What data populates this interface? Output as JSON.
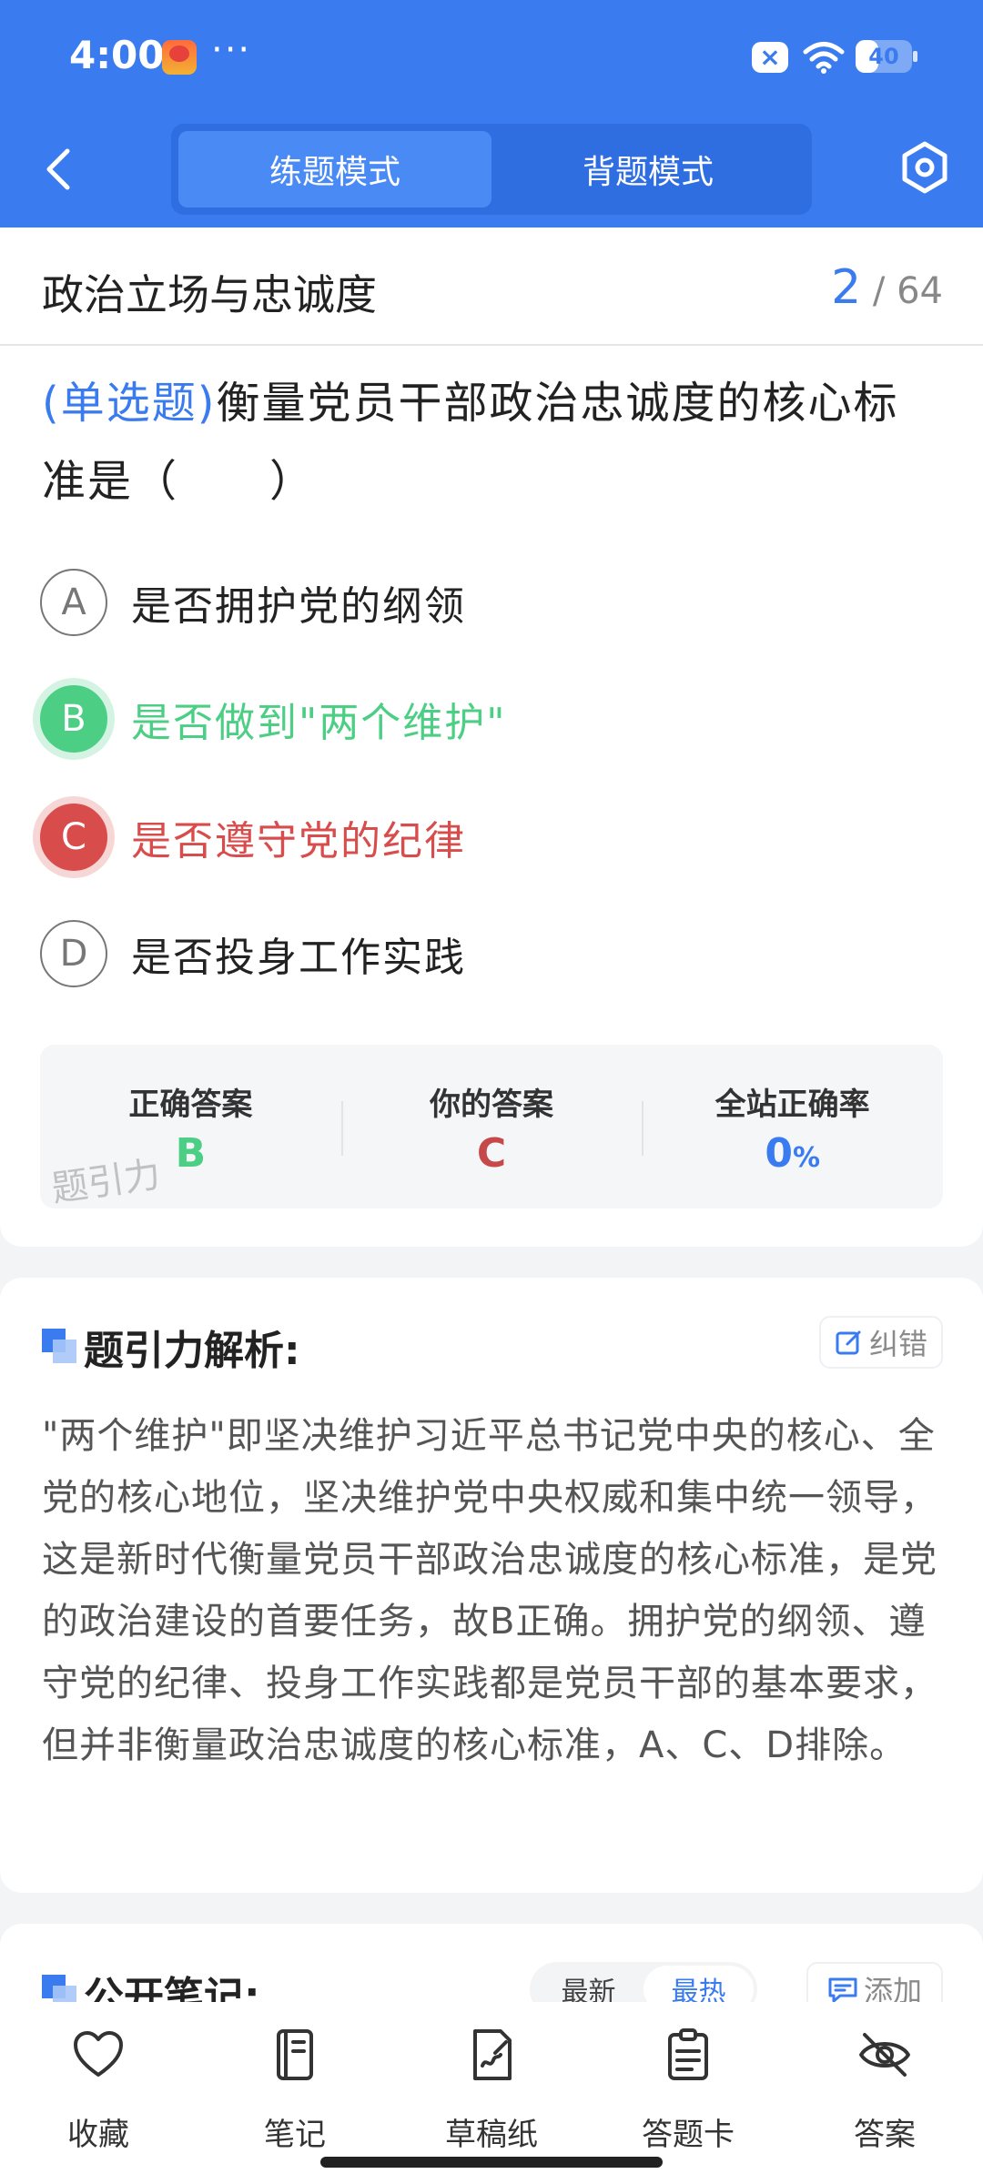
{
  "status_bar": {
    "time": "4:00",
    "dots": "···",
    "battery_level": "40",
    "battery_fraction": 0.4
  },
  "header": {
    "modes": [
      {
        "label": "练题模式",
        "active": true
      },
      {
        "label": "背题模式",
        "active": false
      }
    ]
  },
  "section": {
    "title": "政治立场与忠诚度",
    "current": "2",
    "separator": "/",
    "total": "64"
  },
  "question": {
    "type": "(单选题)",
    "text": "衡量党员干部政治忠诚度的核心标准是（　　）"
  },
  "options": [
    {
      "letter": "A",
      "text": "是否拥护党的纲领",
      "state": "normal"
    },
    {
      "letter": "B",
      "text": "是否做到\"两个维护\"",
      "state": "correct"
    },
    {
      "letter": "C",
      "text": "是否遵守党的纪律",
      "state": "wrong"
    },
    {
      "letter": "D",
      "text": "是否投身工作实践",
      "state": "normal"
    }
  ],
  "answer_summary": {
    "correct_label": "正确答案",
    "correct_value": "B",
    "yours_label": "你的答案",
    "yours_value": "C",
    "rate_label": "全站正确率",
    "rate_value": "0",
    "rate_unit": "%",
    "watermark": "题引力"
  },
  "analysis": {
    "title": "题引力解析:",
    "correct_button": "纠错",
    "text": "\"两个维护\"即坚决维护习近平总书记党中央的核心、全党的核心地位，坚决维护党中央权威和集中统一领导，这是新时代衡量党员干部政治忠诚度的核心标准，是党的政治建设的首要任务，故B正确。拥护党的纲领、遵守党的纪律、投身工作实践都是党员干部的基本要求，但并非衡量政治忠诚度的核心标准，A、C、D排除。"
  },
  "notes": {
    "title": "公开笔记:",
    "sort_options": [
      {
        "label": "最新",
        "active": false
      },
      {
        "label": "最热",
        "active": true
      }
    ],
    "add_button": "添加"
  },
  "bottom_nav": [
    {
      "label": "收藏",
      "icon": "heart-icon"
    },
    {
      "label": "笔记",
      "icon": "notebook-icon"
    },
    {
      "label": "草稿纸",
      "icon": "draft-icon"
    },
    {
      "label": "答题卡",
      "icon": "clipboard-icon"
    },
    {
      "label": "答案",
      "icon": "eye-off-icon"
    }
  ],
  "colors": {
    "primary": "#3a7cf0",
    "correct": "#4ccf84",
    "wrong": "#d84c4c"
  }
}
